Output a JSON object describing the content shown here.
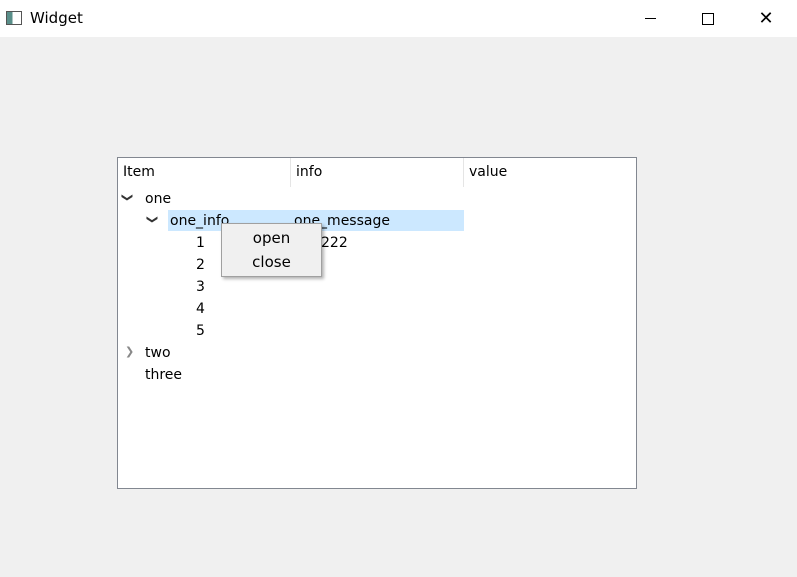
{
  "window": {
    "title": "Widget",
    "icon": "app-window-icon",
    "controls": [
      "minimize-icon",
      "maximize-icon",
      "close-icon"
    ]
  },
  "tree": {
    "headers": [
      "Item",
      "info",
      "value"
    ],
    "rows": [
      {
        "item": "one",
        "expanded": true
      },
      {
        "item": "one_info",
        "info": "one_message",
        "expanded": true,
        "selected": true
      },
      {
        "item": "1",
        "info": "222"
      },
      {
        "item": "2"
      },
      {
        "item": "3"
      },
      {
        "item": "4"
      },
      {
        "item": "5"
      },
      {
        "item": "two",
        "expanded": false
      },
      {
        "item": "three"
      }
    ]
  },
  "context_menu": {
    "items": [
      "open",
      "close"
    ]
  },
  "colors": {
    "selection": "#cce8ff",
    "background": "#f0f0f0"
  }
}
